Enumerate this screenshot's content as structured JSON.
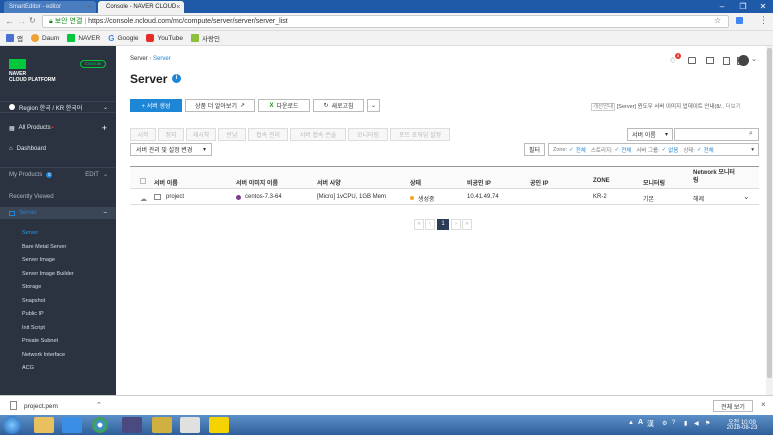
{
  "browser": {
    "tabs": [
      {
        "label": "SmartEditor - editor",
        "active": false
      },
      {
        "label": "Console - NAVER CLOUD",
        "active": true
      }
    ],
    "security_label": "보안 연결",
    "url": "https://console.ncloud.com/mc/compute/server/server/server_list",
    "bookmarks": [
      "앱",
      "Daum",
      "NAVER",
      "Google",
      "YouTube",
      "사랑인"
    ]
  },
  "sidebar": {
    "brand_line1": "NAVER",
    "brand_line2": "CLOUD PLATFORM",
    "console_badge": "Console",
    "region": "Region 한국 / KR 한국어",
    "all_products": "All Products",
    "dashboard": "Dashboard",
    "my_products": "My Products",
    "my_products_count": "0",
    "edit": "EDIT",
    "recently_viewed": "Recently Viewed",
    "server_group": "Server",
    "items": [
      "Server",
      "Bare Metal Server",
      "Server Image",
      "Server Image Builder",
      "Storage",
      "Snapshot",
      "Public IP",
      "Init Script",
      "Private Subnet",
      "Network Interface",
      "ACG"
    ]
  },
  "header": {
    "breadcrumb_root": "Server",
    "breadcrumb_current": "Server",
    "title": "Server",
    "notice_count": "8"
  },
  "toolbar": {
    "create": "+ 서버 생성",
    "learn_more": "상품 더 알아보기",
    "download": "다운로드",
    "refresh": "새로고침",
    "notice_tag": "개선안내",
    "notice_text": "[Server] 윈도우 서버 이미지 업데이트 안내(8/..",
    "notice_more": "더보기"
  },
  "actions": [
    "시작",
    "정지",
    "재시작",
    "반납",
    "접속 관리",
    "서버 접속 콘솔",
    "모니터링",
    "포트 포워딩 설정"
  ],
  "manage_dropdown": "서버 관리 및 설정 변경",
  "search": {
    "field": "서버 이름",
    "placeholder": ""
  },
  "filter": {
    "label": "필터",
    "zone_label": "Zone:",
    "zone_value": "전체",
    "storage_label": "스토리지:",
    "storage_value": "전체",
    "group_label": "서버 그룹:",
    "group_value": "없음",
    "state_label": "상태:",
    "state_value": "전체"
  },
  "table": {
    "headers": [
      "서버 이름",
      "서버 이미지 이름",
      "서버 사양",
      "상태",
      "비공인 IP",
      "공인 IP",
      "ZONE",
      "모니터링",
      "Network 모니터링"
    ],
    "rows": [
      {
        "name": "project",
        "image": "centos-7.3-64",
        "spec": "[Micro] 1vCPU, 1GB Mem",
        "status": "생성중",
        "private_ip": "10.41.49.74",
        "public_ip": "",
        "zone": "KR-2",
        "monitoring": "기본",
        "net_monitoring": "해제"
      }
    ]
  },
  "pagination": {
    "current": "1"
  },
  "download_bar": {
    "file": "project.pem",
    "show_all": "전체 보기"
  },
  "taskbar": {
    "ime1": "A",
    "ime2": "漢",
    "time": "오전 10:09",
    "date": "2018-08-23"
  },
  "colors": {
    "primary": "#1e86d6",
    "sidebar": "#2b3340",
    "accent_green": "#00c73c",
    "status_orange": "#f5a623"
  }
}
